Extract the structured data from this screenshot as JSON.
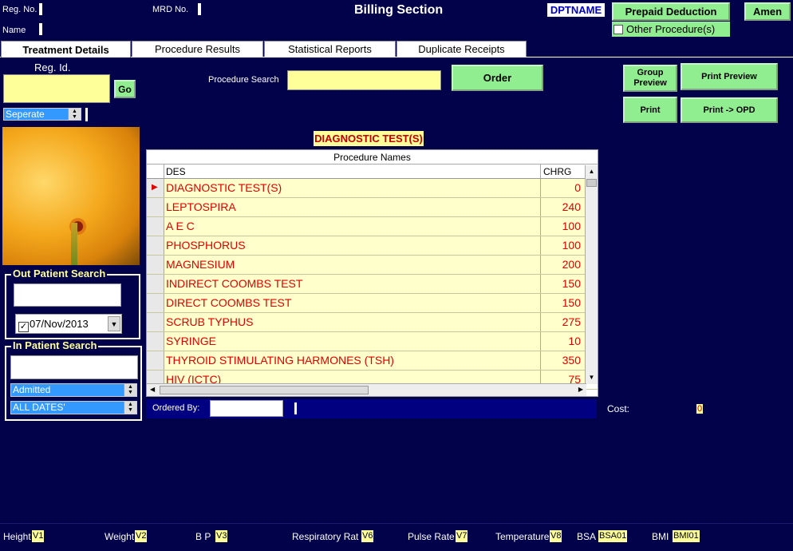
{
  "header": {
    "reg_no_label": "Reg. No.",
    "mrd_no_label": "MRD No.",
    "name_label": "Name",
    "title": "Billing Section",
    "dptname": "DPTNAME",
    "prepaid_label": "Prepaid Deduction",
    "other_proc_label": "Other Procedure(s)",
    "amen_label": "Amen"
  },
  "tabs": [
    {
      "label": "Treatment Details"
    },
    {
      "label": "Procedure Results"
    },
    {
      "label": "Statistical Reports"
    },
    {
      "label": "Duplicate Receipts"
    }
  ],
  "left": {
    "reg_id_label": "Reg. Id.",
    "go_label": "Go",
    "seperate_value": "Seperate",
    "op_search_title": "Out Patient Search",
    "op_date": "07/Nov/2013",
    "ip_search_title": "In Patient Search",
    "ip_status": "Admitted",
    "ip_dates": "ALL DATES'"
  },
  "toolbar": {
    "procedure_search_label": "Procedure Search",
    "order_label": "Order",
    "group_preview_label": "Group Preview",
    "print_preview_label": "Print Preview",
    "print_label": "Print",
    "print_opd_label": "Print -> OPD"
  },
  "section_title": "DIAGNOSTIC TEST(S)",
  "grid": {
    "caption": "Procedure Names",
    "col_des": "DES",
    "col_chrg": "CHRG",
    "rows": [
      {
        "des": "DIAGNOSTIC TEST(S)",
        "chrg": "0"
      },
      {
        "des": "LEPTOSPIRA",
        "chrg": "240"
      },
      {
        "des": "A E C",
        "chrg": "100"
      },
      {
        "des": "PHOSPHORUS",
        "chrg": "100"
      },
      {
        "des": "MAGNESIUM",
        "chrg": "200"
      },
      {
        "des": "INDIRECT COOMBS TEST",
        "chrg": "150"
      },
      {
        "des": "DIRECT COOMBS TEST",
        "chrg": "150"
      },
      {
        "des": "SCRUB TYPHUS",
        "chrg": "275"
      },
      {
        "des": "SYRINGE",
        "chrg": "10"
      },
      {
        "des": "THYROID STIMULATING HARMONES (TSH)",
        "chrg": "350"
      },
      {
        "des": "HIV (ICTC)",
        "chrg": "75"
      }
    ]
  },
  "ordered_by_label": "Ordered By:",
  "cost_label": "Cost:",
  "cost_value": "0",
  "vitals": {
    "height_label": "Height",
    "height_value": "V1",
    "weight_label": "Weight",
    "weight_value": "V2",
    "bp_label": "B P",
    "bp_value": "V3",
    "resp_label": "Respiratory Rat",
    "resp_value": "V6",
    "pulse_label": "Pulse Rate",
    "pulse_value": "V7",
    "temp_label": "Temperature",
    "temp_value": "V8",
    "bsa_label": "BSA",
    "bsa_value": "BSA01",
    "bmi_label": "BMI",
    "bmi_value": "BMI01"
  },
  "colors": {
    "background": "#02024a",
    "yellow_field": "#ffff99",
    "button_green": "#90ee90",
    "row_text": "#e00000"
  }
}
